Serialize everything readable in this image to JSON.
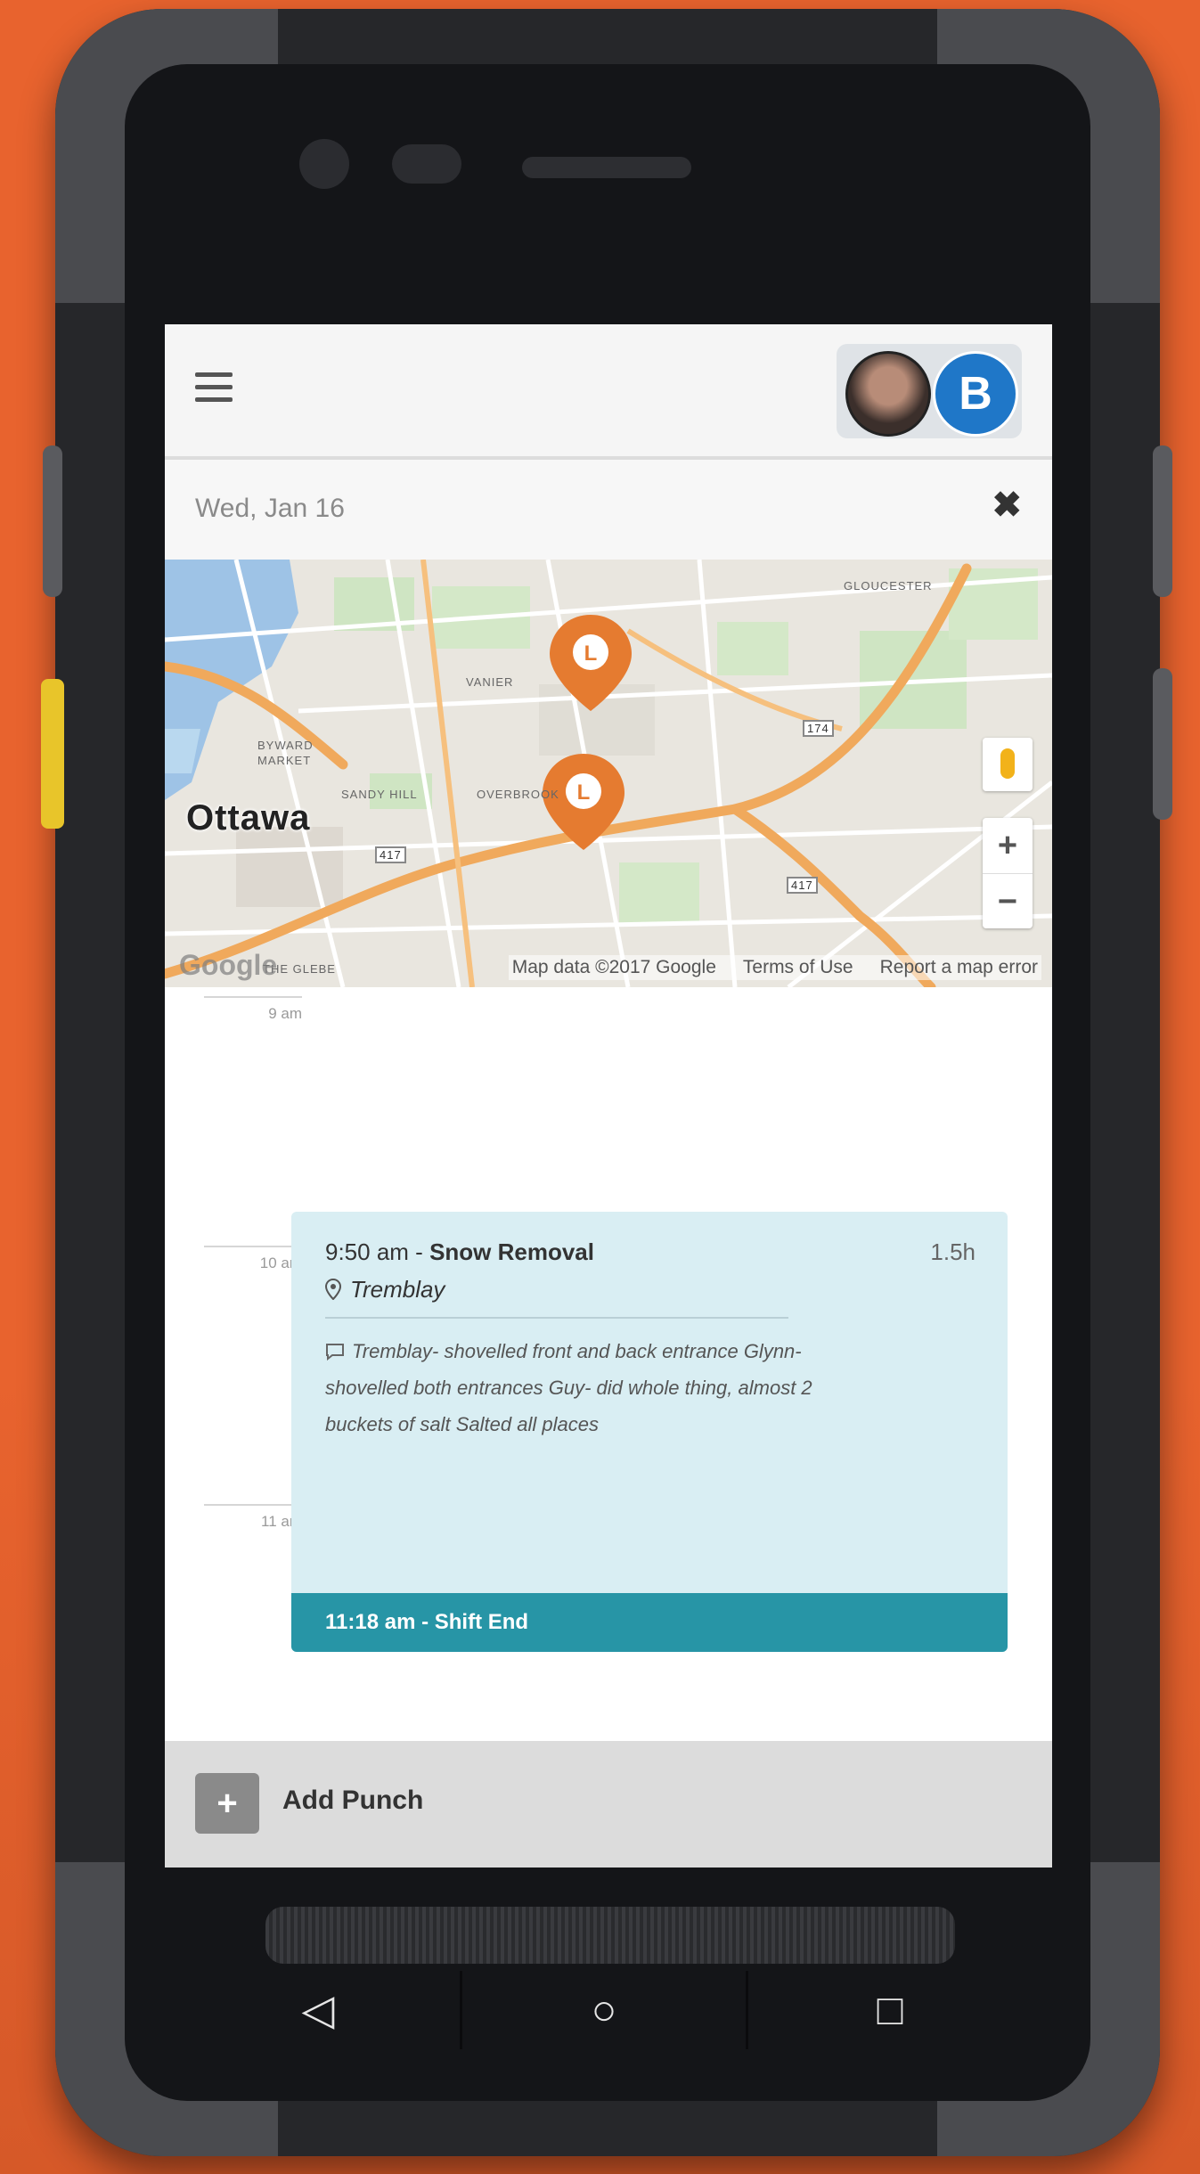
{
  "header": {
    "avatar_brand_letter": "B"
  },
  "day": {
    "date": "Wed, Jan 16",
    "close_glyph": "✖"
  },
  "map": {
    "city_label": "Ottawa",
    "area_labels": [
      "VANIER",
      "BYWARD MARKET",
      "SANDY HILL",
      "OVERBROOK",
      "GLOUCESTER",
      "THE GLEBE"
    ],
    "highway_shields": [
      "417",
      "417",
      "174"
    ],
    "google_logo": "Google",
    "attribution": {
      "data": "Map data ©2017 Google",
      "terms": "Terms of Use",
      "report": "Report a map error"
    },
    "zoom_in": "+",
    "zoom_out": "−",
    "pin_glyph": "L"
  },
  "timeline": {
    "time_labels": [
      "9 am",
      "10 am",
      "11 am"
    ],
    "entry": {
      "start_time": "9:50 am - ",
      "job": "Snow Removal",
      "duration": "1.5h",
      "location": "Tremblay",
      "note": "Tremblay- shovelled front and back entrance Glynn- shovelled both entrances Guy- did whole thing, almost 2 buckets of salt Salted all places",
      "shift_end": "11:18 am - Shift End"
    }
  },
  "footer": {
    "add_label": "Add Punch",
    "add_glyph": "+"
  },
  "android_nav": {
    "back": "◁",
    "home": "○",
    "recent": "□"
  },
  "colors": {
    "background": "#e8632e",
    "accent": "#2795a6",
    "card": "#d9eef3",
    "pin": "#e57b30"
  }
}
